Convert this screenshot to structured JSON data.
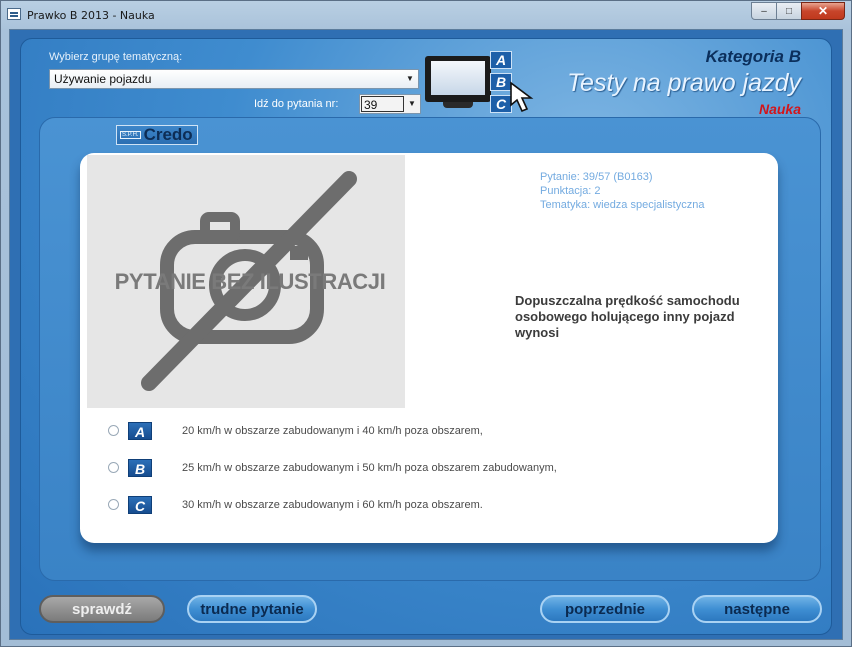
{
  "window": {
    "title": "Prawko B 2013 - Nauka",
    "controls": {
      "minimize": "‒",
      "maximize": "□",
      "close": "✕"
    }
  },
  "header": {
    "topic_label": "Wybierz grupę tematyczną:",
    "topic_value": "Używanie pojazdu",
    "goto_label": "Idź do pytania nr:",
    "goto_value": "39",
    "abc": [
      "A",
      "B",
      "C"
    ],
    "brand_category": "Kategoria B",
    "brand_title": "Testy na prawo jazdy",
    "brand_mode": "Nauka"
  },
  "logo": {
    "small": "S.P.H.",
    "name": "Credo"
  },
  "question": {
    "illustration_text": "PYTANIE BEZ ILUSTRACJI",
    "meta_number": "Pytanie: 39/57 (B0163)",
    "meta_points": "Punktacja: 2",
    "meta_topic": "Tematyka: wiedza specjalistyczna",
    "text": "Dopuszczalna prędkość samochodu osobowego holującego inny pojazd wynosi",
    "answers": [
      {
        "letter": "A",
        "text": "20 km/h w obszarze zabudowanym i 40 km/h poza obszarem,"
      },
      {
        "letter": "B",
        "text": "25 km/h w obszarze zabudowanym i 50 km/h poza obszarem zabudowanym,"
      },
      {
        "letter": "C",
        "text": "30 km/h w obszarze zabudowanym i 60 km/h poza obszarem."
      }
    ]
  },
  "buttons": {
    "check": "sprawdź",
    "hard": "trudne pytanie",
    "prev": "poprzednie",
    "next": "następne"
  },
  "colors": {
    "accent": "#2f6fb3",
    "brand_red": "#d3151a",
    "meta_text": "#74abe0"
  }
}
